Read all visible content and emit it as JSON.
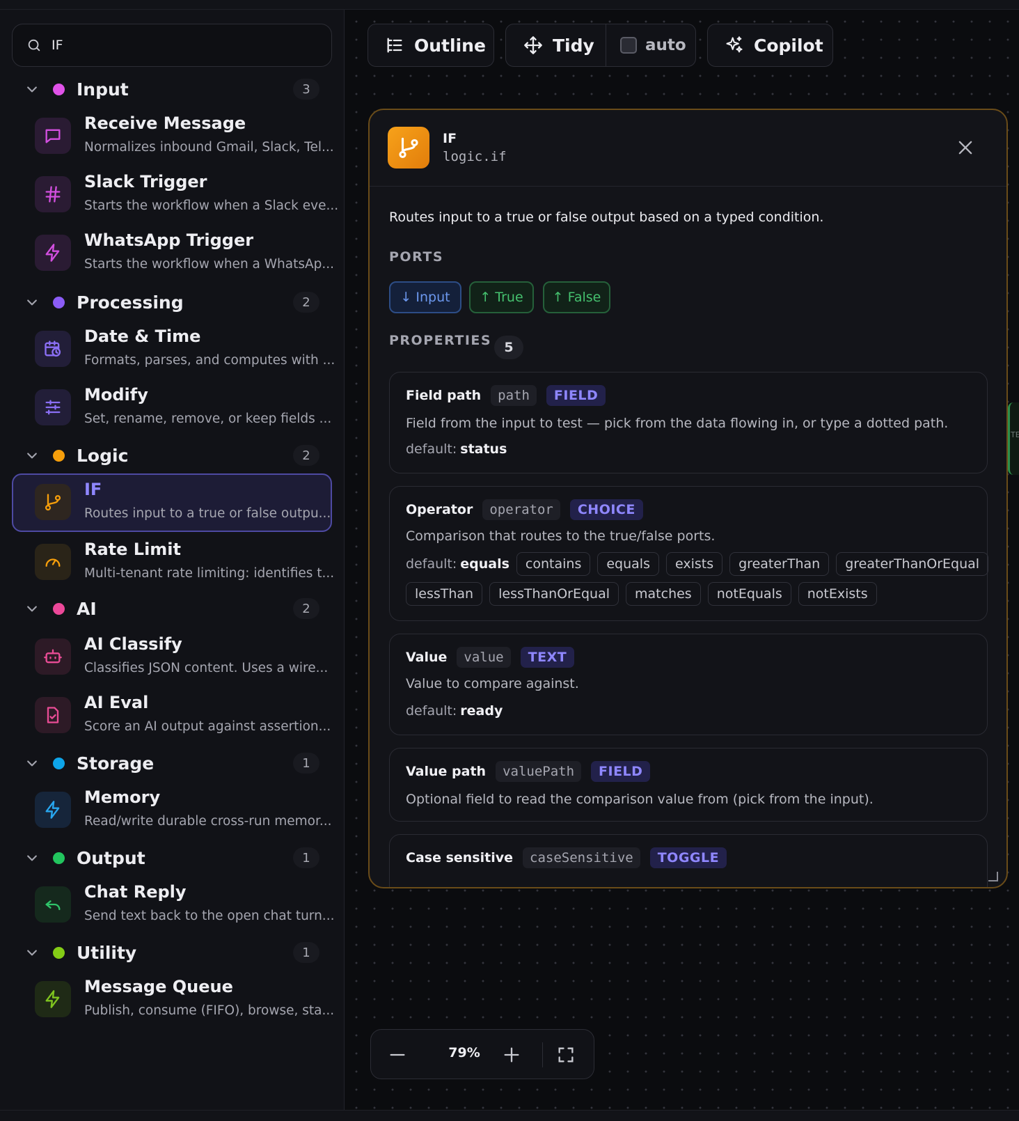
{
  "search": {
    "value": "IF"
  },
  "categories": [
    {
      "label": "Input",
      "count": "3",
      "color": "#e052e8"
    },
    {
      "label": "Processing",
      "count": "2",
      "color": "#8b5cf6"
    },
    {
      "label": "Logic",
      "count": "2",
      "color": "#f59e0b"
    },
    {
      "label": "AI",
      "count": "2",
      "color": "#ec4899"
    },
    {
      "label": "Storage",
      "count": "1",
      "color": "#0ea5e9"
    },
    {
      "label": "Output",
      "count": "1",
      "color": "#22c55e"
    },
    {
      "label": "Utility",
      "count": "1",
      "color": "#84cc16"
    }
  ],
  "nodes": [
    {
      "title": "Receive Message",
      "desc": "Normalizes inbound Gmail, Slack, Tel...",
      "icon": "message-square-icon"
    },
    {
      "title": "Slack Trigger",
      "desc": "Starts the workflow when a Slack eve...",
      "icon": "hash-icon"
    },
    {
      "title": "WhatsApp Trigger",
      "desc": "Starts the workflow when a WhatsAp...",
      "icon": "zap-icon"
    },
    {
      "title": "Date & Time",
      "desc": "Formats, parses, and computes with ...",
      "icon": "calendar-clock-icon"
    },
    {
      "title": "Modify",
      "desc": "Set, rename, remove, or keep fields ...",
      "icon": "sliders-icon"
    },
    {
      "title": "IF",
      "desc": "Routes input to a true or false outpu...",
      "icon": "git-branch-icon"
    },
    {
      "title": "Rate Limit",
      "desc": "Multi-tenant rate limiting: identifies t...",
      "icon": "gauge-icon"
    },
    {
      "title": "AI Classify",
      "desc": "Classifies JSON content. Uses a wire...",
      "icon": "bot-icon"
    },
    {
      "title": "AI Eval",
      "desc": "Score an AI output against assertion...",
      "icon": "file-check-icon"
    },
    {
      "title": "Memory",
      "desc": "Read/write durable cross-run memor...",
      "icon": "zap-icon"
    },
    {
      "title": "Chat Reply",
      "desc": "Send text back to the open chat turn...",
      "icon": "reply-icon"
    },
    {
      "title": "Message Queue",
      "desc": "Publish, consume (FIFO), browse, sta...",
      "icon": "zap-icon"
    }
  ],
  "toolbar": {
    "outline": "Outline",
    "tidy": "Tidy",
    "auto": "auto",
    "copilot": "Copilot"
  },
  "panel": {
    "title": "IF",
    "type": "logic.if",
    "description": "Routes input to a true or false output based on a typed condition.",
    "ports_heading": "PORTS",
    "ports": [
      "↓ Input",
      "↑ True",
      "↑ False"
    ],
    "properties_heading": "PROPERTIES",
    "properties_count": "5",
    "properties": [
      {
        "label": "Field path",
        "key": "path",
        "type": "FIELD",
        "desc": "Field from the input to test — pick from the data flowing in, or type a dotted path.",
        "default_label": "default:",
        "default": "status"
      },
      {
        "label": "Operator",
        "key": "operator",
        "type": "CHOICE",
        "desc": "Comparison that routes to the true/false ports.",
        "default_label": "default:",
        "default": "equals",
        "options": [
          "contains",
          "equals",
          "exists",
          "greaterThan",
          "greaterThanOrEqual",
          "lessThan",
          "lessThanOrEqual",
          "matches",
          "notEquals",
          "notExists"
        ]
      },
      {
        "label": "Value",
        "key": "value",
        "type": "TEXT",
        "desc": "Value to compare against.",
        "default_label": "default:",
        "default": "ready"
      },
      {
        "label": "Value path",
        "key": "valuePath",
        "type": "FIELD",
        "desc": "Optional field to read the comparison value from (pick from the input)."
      },
      {
        "label": "Case sensitive",
        "key": "caseSensitive",
        "type": "TOGGLE"
      }
    ]
  },
  "zoom": {
    "level": "79%"
  },
  "colors": {
    "accent": "#8f87ff",
    "panel_border": "#6a4c19",
    "if_icon": "#f59e0b"
  }
}
